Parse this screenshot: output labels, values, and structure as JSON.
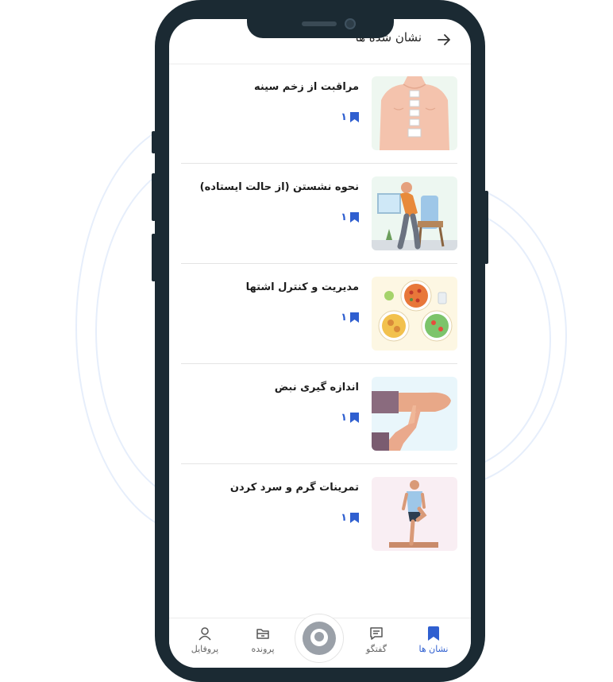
{
  "header": {
    "title": "نشان شده ها"
  },
  "items": [
    {
      "title": "مراقبت از زخم سینه",
      "count": "۱",
      "image": "chest-wound-illustration"
    },
    {
      "title": "نحوه نشستن (از حالت ایستاده)",
      "count": "۱",
      "image": "sitting-man-illustration"
    },
    {
      "title": "مدیریت و کنترل اشتها",
      "count": "۱",
      "image": "food-plates-illustration"
    },
    {
      "title": "اندازه گیری نبض",
      "count": "۱",
      "image": "pulse-check-illustration"
    },
    {
      "title": "تمرینات گرم و سرد کردن",
      "count": "۱",
      "image": "stretching-man-illustration"
    }
  ],
  "tabs": [
    {
      "label": "نشان ها",
      "icon": "bookmark-icon",
      "active": true
    },
    {
      "label": "گفتگو",
      "icon": "chat-icon",
      "active": false
    },
    {
      "label": "پرونده",
      "icon": "folder-icon",
      "active": false
    },
    {
      "label": "پروفایل",
      "icon": "user-icon",
      "active": false
    }
  ],
  "colors": {
    "accent": "#2f5fd0",
    "phone_frame": "#1b2a33",
    "text": "#1c1c1c"
  }
}
